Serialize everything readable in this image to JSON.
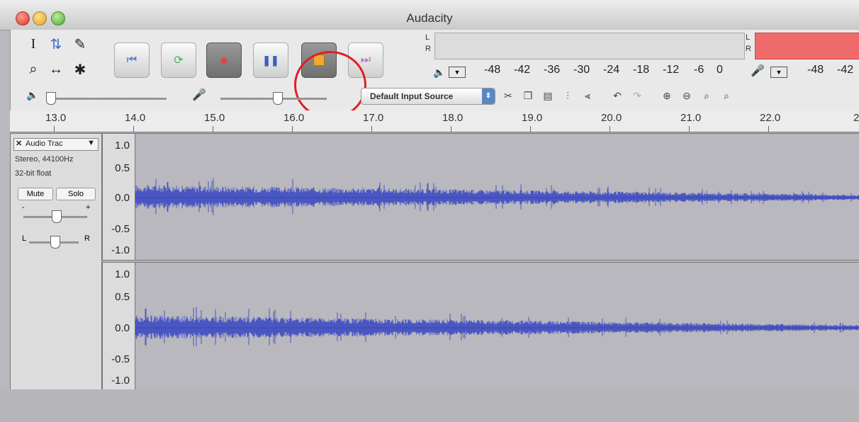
{
  "window": {
    "title": "Audacity"
  },
  "tools": {
    "selection": "I",
    "envelope": "⇅",
    "draw": "✎",
    "zoom": "⌕",
    "timeshift": "↔",
    "multi": "✱"
  },
  "transport": {
    "skip_start": "⏮",
    "play": "▶",
    "record": "●",
    "pause": "❚❚",
    "stop": "■",
    "skip_end": "⏭"
  },
  "meters": {
    "playback": {
      "L": "L",
      "R": "R",
      "scale": [
        "-48",
        "-42",
        "-36",
        "-30",
        "-24",
        "-18",
        "-12",
        "-6",
        "0"
      ]
    },
    "record": {
      "L": "L",
      "R": "R",
      "scale": [
        "-48",
        "-42"
      ]
    }
  },
  "mixer": {
    "input_source": "Default Input Source"
  },
  "ruler": {
    "ticks": [
      "13.0",
      "14.0",
      "15.0",
      "16.0",
      "17.0",
      "18.0",
      "19.0",
      "20.0",
      "21.0",
      "22.0",
      "2"
    ]
  },
  "track": {
    "name": "Audio Trac",
    "format": "Stereo, 44100Hz",
    "bit_depth": "32-bit float",
    "mute_label": "Mute",
    "solo_label": "Solo",
    "gain_minus": "-",
    "gain_plus": "+",
    "pan_left": "L",
    "pan_right": "R",
    "channel1_scale": [
      "1.0",
      "0.5",
      "0.0",
      "-0.5",
      "-1.0"
    ],
    "channel2_scale": [
      "1.0",
      "0.5",
      "0.0",
      "-0.5",
      "-1.0"
    ]
  },
  "colors": {
    "waveform": "#4a56c2",
    "highlight_circle": "#e01f22",
    "record_meter": "#ef6b6b"
  }
}
